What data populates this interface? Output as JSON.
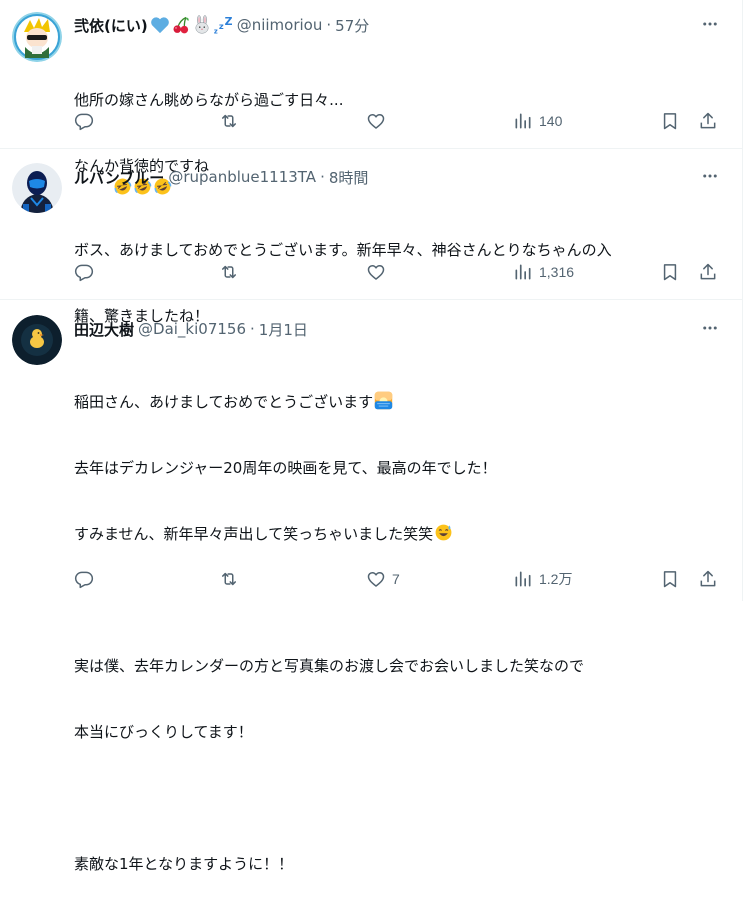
{
  "tweets": [
    {
      "display_name": "弐依(にい)",
      "handle": "@niimoriou",
      "separator": "·",
      "time": "57分",
      "lines": [
        "他所の嫁さん眺めらながら過ごす日々...",
        "なんか背徳的ですね"
      ],
      "line_emojis": [
        "",
        "rofl-x3"
      ],
      "name_emojis": [
        "blue-heart-icon",
        "cherries-icon",
        "rabbit-icon",
        "zzz-icon"
      ],
      "replies": "",
      "retweets": "",
      "likes": "",
      "views": "140"
    },
    {
      "display_name": "ルパンブルー",
      "handle": "@rupanblue1113TA",
      "separator": "·",
      "time": "8時間",
      "lines": [
        "ボス、あけましておめでとうございます。新年早々、神谷さんとりなちゃんの入",
        "籍、驚きましたね！"
      ],
      "line_emojis": [
        "",
        ""
      ],
      "name_emojis": [],
      "replies": "",
      "retweets": "",
      "likes": "",
      "views": "1,316"
    },
    {
      "display_name": "田辺大樹",
      "handle": "@Dai_ki07156",
      "separator": "·",
      "time": "1月1日",
      "lines": [
        "稲田さん、あけましておめでとうございます",
        "去年はデカレンジャー20周年の映画を見て、最高の年でした！",
        "すみません、新年早々声出して笑っちゃいました笑笑",
        "",
        "実は僕、去年カレンダーの方と写真集のお渡し会でお会いしました笑なので",
        "本当にびっくりしてます！",
        "",
        "素敵な1年となりますように！！"
      ],
      "line_emojis": [
        "sunrise-icon",
        "",
        "sweat-smile-icon",
        "",
        "",
        "",
        "",
        ""
      ],
      "name_emojis": [],
      "replies": "",
      "retweets": "",
      "likes": "7",
      "views": "1.2万"
    }
  ],
  "colors": {
    "text": "#0f1419",
    "muted": "#536471",
    "divider": "#eff3f4",
    "heart_blue": "#5dade2"
  }
}
